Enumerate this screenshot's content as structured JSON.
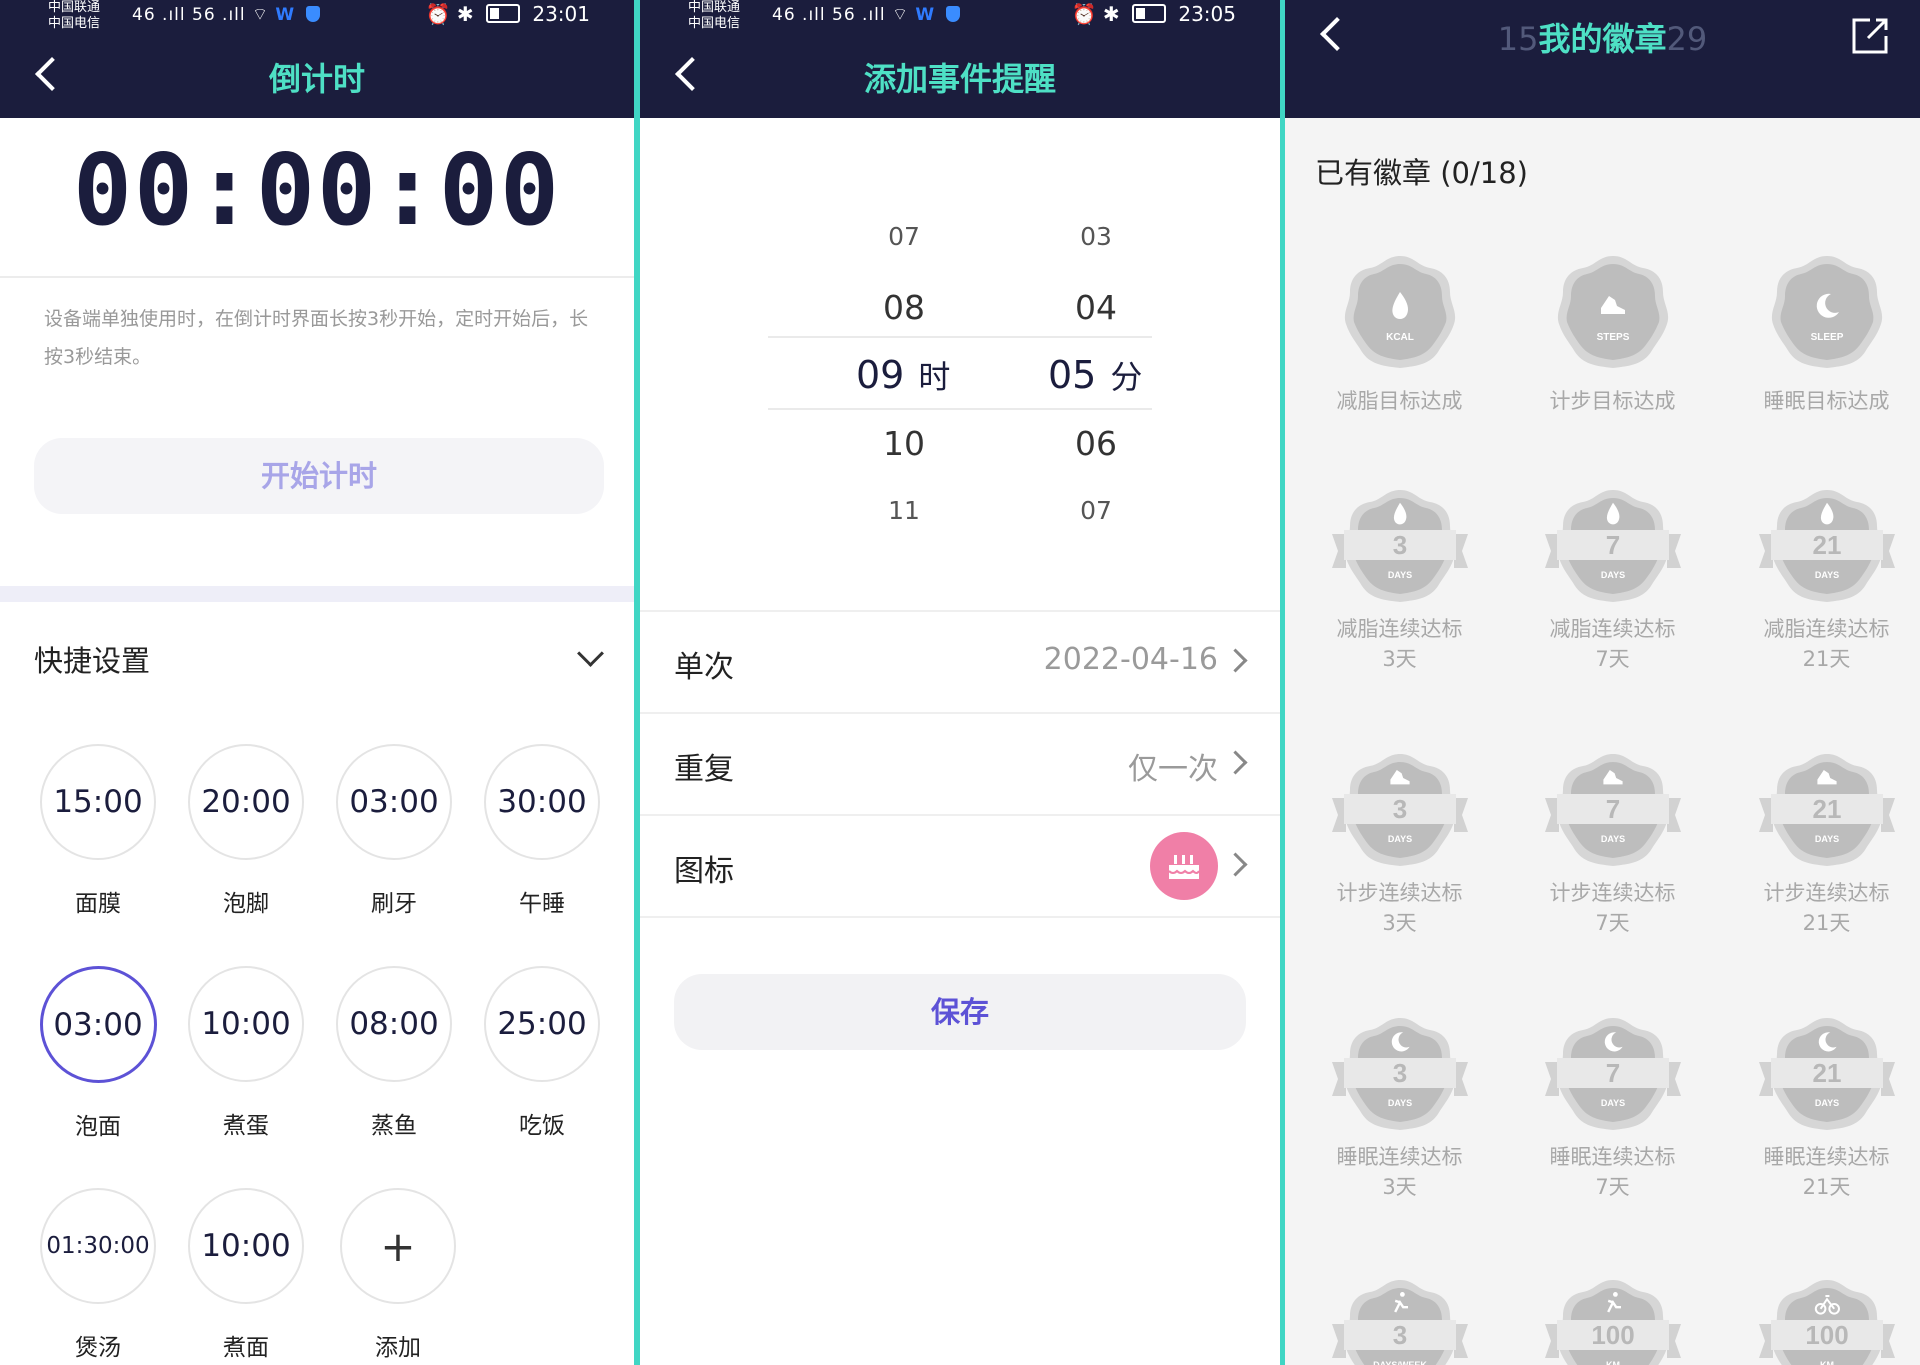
{
  "panel1": {
    "status": {
      "carrier1": "中国联通",
      "carrier2": "中国电信",
      "network": "46 .ıll 56 .ıll",
      "time": "23:01"
    },
    "title": "倒计时",
    "timer": "00:00:00",
    "tip": "设备端单独使用时，在倒计时界面长按3秒开始，定时开始后，长按3秒结束。",
    "start_button": "开始计时",
    "quick_settings": "快捷设置",
    "presets": [
      {
        "time": "15:00",
        "label": "面膜"
      },
      {
        "time": "20:00",
        "label": "泡脚"
      },
      {
        "time": "03:00",
        "label": "刷牙"
      },
      {
        "time": "30:00",
        "label": "午睡"
      },
      {
        "time": "03:00",
        "label": "泡面"
      },
      {
        "time": "10:00",
        "label": "煮蛋"
      },
      {
        "time": "08:00",
        "label": "蒸鱼"
      },
      {
        "time": "25:00",
        "label": "吃饭"
      },
      {
        "time": "01:30:00",
        "label": "煲汤"
      },
      {
        "time": "10:00",
        "label": "煮面"
      },
      {
        "time": "+",
        "label": "添加"
      }
    ]
  },
  "panel2": {
    "status": {
      "carrier1": "中国联通",
      "carrier2": "中国电信",
      "network": "46 .ıll 56 .ıll",
      "time": "23:05"
    },
    "title": "添加事件提醒",
    "hours": [
      "07",
      "08",
      "09",
      "10",
      "11"
    ],
    "minutes": [
      "03",
      "04",
      "05",
      "06",
      "07"
    ],
    "hour_unit": "时",
    "minute_unit": "分",
    "rows": {
      "once_label": "单次",
      "once_value": "2022-04-16",
      "repeat_label": "重复",
      "repeat_value": "仅一次",
      "icon_label": "图标"
    },
    "save_button": "保存"
  },
  "panel3": {
    "title_ghost_left": "15",
    "title": "我的徽章",
    "title_ghost_right": "29",
    "have_badges": "已有徽章 (0/18)",
    "badges": [
      {
        "label1": "减脂目标达成",
        "label2": "",
        "text": "KCAL",
        "type": "hex",
        "icon": "flame-icon"
      },
      {
        "label1": "计步目标达成",
        "label2": "",
        "text": "STEPS",
        "type": "hex",
        "icon": "shoe-icon"
      },
      {
        "label1": "睡眠目标达成",
        "label2": "",
        "text": "SLEEP",
        "type": "hex",
        "icon": "moon-icon"
      },
      {
        "label1": "减脂连续达标",
        "label2": "3天",
        "text": "3",
        "sub": "DAYS",
        "type": "ribbon",
        "icon": "flame-icon"
      },
      {
        "label1": "减脂连续达标",
        "label2": "7天",
        "text": "7",
        "sub": "DAYS",
        "type": "ribbon",
        "icon": "flame-icon"
      },
      {
        "label1": "减脂连续达标",
        "label2": "21天",
        "text": "21",
        "sub": "DAYS",
        "type": "ribbon",
        "icon": "flame-icon"
      },
      {
        "label1": "计步连续达标",
        "label2": "3天",
        "text": "3",
        "sub": "DAYS",
        "type": "ribbon",
        "icon": "shoe-icon"
      },
      {
        "label1": "计步连续达标",
        "label2": "7天",
        "text": "7",
        "sub": "DAYS",
        "type": "ribbon",
        "icon": "shoe-icon"
      },
      {
        "label1": "计步连续达标",
        "label2": "21天",
        "text": "21",
        "sub": "DAYS",
        "type": "ribbon",
        "icon": "shoe-icon"
      },
      {
        "label1": "睡眠连续达标",
        "label2": "3天",
        "text": "3",
        "sub": "DAYS",
        "type": "ribbon",
        "icon": "moon-icon"
      },
      {
        "label1": "睡眠连续达标",
        "label2": "7天",
        "text": "7",
        "sub": "DAYS",
        "type": "ribbon",
        "icon": "moon-icon"
      },
      {
        "label1": "睡眠连续达标",
        "label2": "21天",
        "text": "21",
        "sub": "DAYS",
        "type": "ribbon",
        "icon": "moon-icon"
      },
      {
        "label1": "",
        "label2": "",
        "text": "3",
        "sub": "DAYS/WEEK",
        "type": "ribbon",
        "icon": "runner-icon"
      },
      {
        "label1": "",
        "label2": "",
        "text": "100",
        "sub": "KM",
        "type": "ribbon",
        "icon": "runner-icon"
      },
      {
        "label1": "",
        "label2": "",
        "text": "100",
        "sub": "KM",
        "type": "ribbon",
        "icon": "bike-icon"
      }
    ]
  },
  "colors": {
    "header": "#1b1d3d",
    "title_accent": "#4ee0c5",
    "selected_ring": "#5d52d6",
    "badge_grey": "#c4c4c4",
    "icon_pink": "#f07fa7"
  }
}
